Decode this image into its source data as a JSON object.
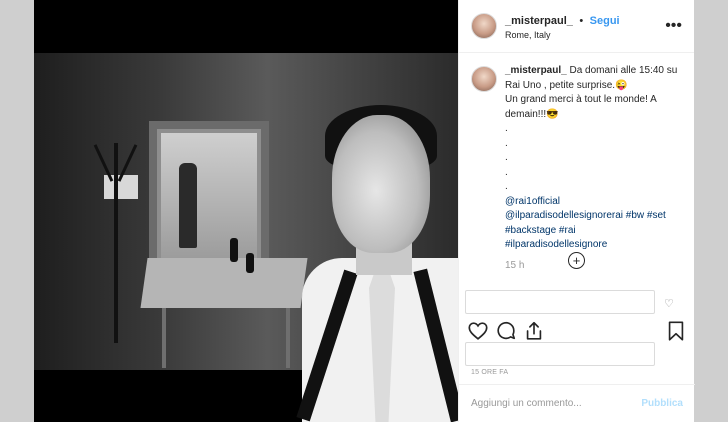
{
  "post": {
    "username": "_misterpaul_",
    "follow_label": "Segui",
    "dot": "•",
    "location": "Rome, Italy"
  },
  "caption": {
    "username": "_misterpaul_",
    "line1": " Da domani alle 15:40 su Rai Uno , petite surprise.😜",
    "line2": "Un grand merci à tout le monde! A demain!!!😎",
    "dots": [
      ".",
      ".",
      ".",
      ".",
      "."
    ],
    "tag1": "@rai1official",
    "tag2": "@ilparadisodellesignorerai #bw #set",
    "tag3": "#backstage #rai",
    "tag4": "#ilparadisodellesignore",
    "timestamp": "15 h"
  },
  "footer": {
    "time_small": "15 ORE FA",
    "comment_placeholder": "Aggiungi un commento...",
    "publish_label": "Pubblica"
  },
  "icons": {
    "more": "more-options-icon",
    "add": "add-circle-icon",
    "like": "heart-icon",
    "comment": "comment-icon",
    "share": "share-icon",
    "save": "bookmark-icon"
  },
  "colors": {
    "link": "#3897f0",
    "hashtag": "#003569",
    "text": "#262626",
    "muted": "#999999",
    "publish_disabled": "#b2dffc"
  }
}
